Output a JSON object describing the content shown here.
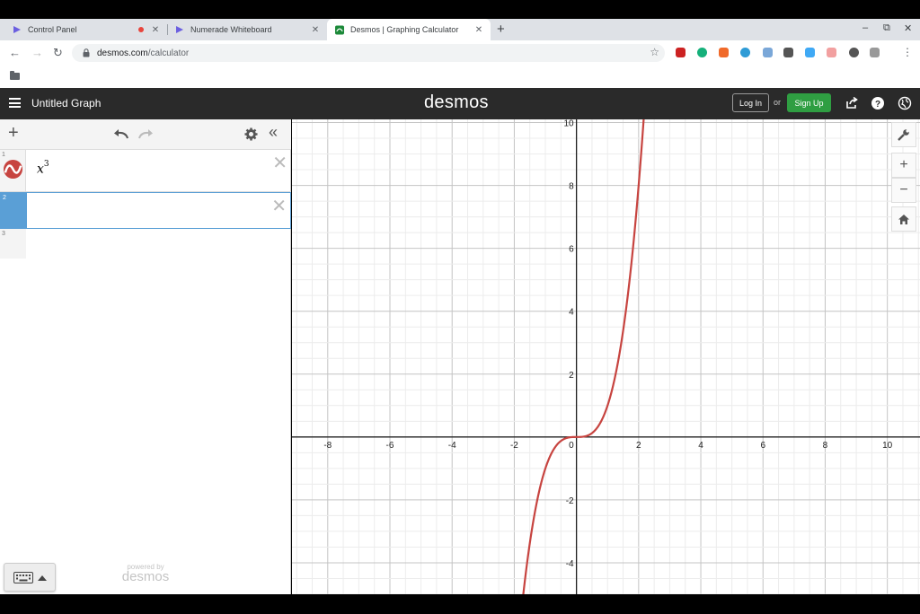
{
  "browser": {
    "tabs": [
      {
        "title": "Control Panel"
      },
      {
        "title": "Numerade Whiteboard"
      },
      {
        "title": "Desmos | Graphing Calculator"
      }
    ],
    "url_domain": "desmos.com",
    "url_path": "/calculator"
  },
  "header": {
    "graph_title": "Untitled Graph",
    "logo": "desmos",
    "login_label": "Log In",
    "or_label": "or",
    "signup_label": "Sign Up"
  },
  "expressions": [
    {
      "number": "1",
      "base": "x",
      "exponent": "3",
      "color": "#c74440"
    },
    {
      "number": "2",
      "base": "",
      "exponent": ""
    },
    {
      "number": "3",
      "base": "",
      "exponent": ""
    }
  ],
  "footer": {
    "powered_small": "powered by",
    "powered_logo": "desmos"
  },
  "graph": {
    "x_range": [
      -9.15,
      11.05
    ],
    "y_range": [
      -5.0,
      10.1
    ],
    "x_ticks": [
      "-8",
      "-6",
      "-4",
      "-2",
      "2",
      "4",
      "6",
      "8",
      "10"
    ],
    "y_ticks": [
      "-4",
      "-2",
      "2",
      "4",
      "6",
      "8",
      "10"
    ],
    "origin_label": "0",
    "curve_color": "#c74440",
    "icons": [
      "wrench-icon",
      "zoom-in-icon",
      "zoom-out-icon",
      "home-icon"
    ]
  }
}
